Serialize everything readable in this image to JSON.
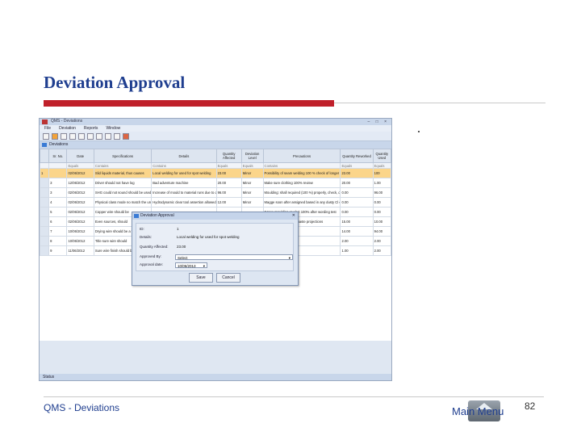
{
  "slide": {
    "title": "Deviation Approval",
    "footer": "QMS - Deviations",
    "home_label": "Main Menu",
    "page_number": "82"
  },
  "app": {
    "title": "QMS - Deviations",
    "window_buttons": "– □ ×",
    "menu": [
      "File",
      "Deviation",
      "Reports",
      "Window"
    ],
    "doc_tab": "Deviations",
    "status": "Status",
    "columns": [
      "Sr. No.",
      "Date",
      "Specifications",
      "Details",
      "Quantity Affected",
      "Deviation Level",
      "Precautions",
      "Quantity Reworked",
      "Quantity Used"
    ],
    "filter": [
      "",
      "Equals",
      "Contains",
      "Contains",
      "Equals",
      "Equals",
      "Contains",
      "Equals",
      "Equals"
    ],
    "rows": [
      {
        "rh": "1",
        "sel": true,
        "c": [
          "",
          "02/06/2012",
          "Slid liquids material, thus causes",
          "Local welding for used for spot welding",
          "23.00",
          "Minor",
          "Possibility of seam welding 100 % check of longer welding required",
          "23.00",
          "100"
        ]
      },
      {
        "rh": "",
        "c": [
          "3",
          "12/06/2012",
          "Driver should not have log",
          "Bad adventure machine",
          "20.00",
          "Minor",
          "Make sure clothing 100% review",
          "20.00",
          "1.00"
        ]
      },
      {
        "rh": "",
        "c": [
          "3",
          "02/06/2012",
          "SHG could not sound should be used to cool change and set to the time of moulding",
          "Increase of mould to material runs due to down dress of mould cooling plant",
          "96.00",
          "Minor",
          "Moulding: shall required (100 %) properly, check, degree of change, clears slide rule in short stock",
          "0.00",
          "96.00"
        ]
      },
      {
        "rh": "",
        "c": [
          "4",
          "02/06/2012",
          "Physical class mode no match the units in CIST run",
          "Hydrodynamic clear tool assertion allowed limit of 0.001 sec",
          "12.00",
          "Minor",
          "Magge soon after assigned based in any dusty Cl cover in production",
          "0.00",
          "0.00"
        ]
      },
      {
        "rh": "",
        "c": [
          "5",
          "02/06/2012",
          "Copper wire should be",
          "",
          "",
          "",
          "Screw moulding or alert 100% after wording test",
          "0.00",
          "0.00"
        ]
      },
      {
        "rh": "",
        "c": [
          "6",
          "02/06/2012",
          "Even sources, should",
          "",
          "",
          "",
          "Operator to operate, chaste projections",
          "15.00",
          "10.00"
        ]
      },
      {
        "rh": "",
        "c": [
          "7",
          "10/06/2012",
          "Drying wire should be a variance to check",
          "",
          "",
          "",
          "Make plated",
          "14.00",
          "94.00"
        ]
      },
      {
        "rh": "",
        "c": [
          "8",
          "10/06/2012",
          "Title sure wire should",
          "",
          "",
          "",
          "Take",
          "2.00",
          "2.00"
        ]
      },
      {
        "rh": "",
        "c": [
          "9",
          "11/06/2012",
          "Sure wire finish should be",
          "",
          "",
          "",
          "Pin and in filling",
          "1.00",
          "2.00"
        ]
      }
    ]
  },
  "dialog": {
    "title": "Deviation Approval",
    "id_label": "ID:",
    "id_value": "1",
    "details_label": "Details:",
    "details_value": "Local welding for used for spot welding",
    "qty_label": "Quantity Affected:",
    "qty_value": "23.00",
    "approved_by_label": "Approved By:",
    "approved_by_value": "Select",
    "approval_date_label": "Approval date:",
    "approval_date_value": "10/06/2013",
    "save_label": "Save",
    "cancel_label": "Cancel"
  }
}
